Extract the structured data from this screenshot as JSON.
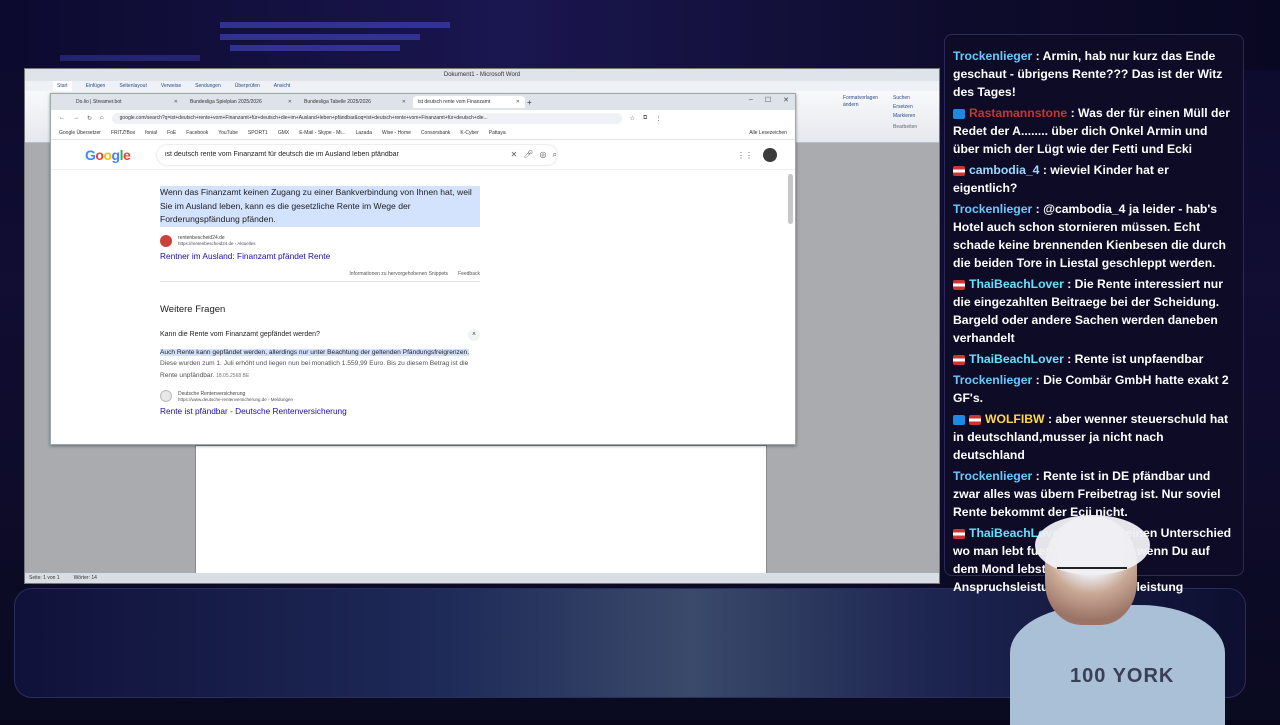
{
  "word": {
    "title": "Dokument1 - Microsoft Word",
    "tabs": [
      "Start",
      "Einfügen",
      "Seitenlayout",
      "Verweise",
      "Sendungen",
      "Überprüfen",
      "Ansicht"
    ],
    "status": [
      "Seite: 1 von 1",
      "Wörter: 14"
    ],
    "ribbon_right": [
      "Formatvorlagen ändern",
      "Suchen",
      "Ersetzen",
      "Markieren",
      "Bearbeiten"
    ]
  },
  "browser": {
    "tabs": [
      {
        "label": "Do.lio | Streamer.bot"
      },
      {
        "label": "Bundesliga Spielplan 2025/2026"
      },
      {
        "label": "Bundesliga Tabelle 2025/2026"
      },
      {
        "label": "ist deutsch rente vom Finanzamt"
      }
    ],
    "url": "google.com/search?q=ist+deutsch+rente+vom+Finanzamt+für+deutsch+die+im+Ausland+leben+pfändbar&oq=ist+deutsch+rente+vom+Finanzamt+für+deutsch+die...",
    "bookmarks": [
      "Google Übersetzer",
      "FRITZ!Box",
      "fonial",
      "FoE",
      "Facebook",
      "YouTube",
      "SPORT1",
      "GMX",
      "E-Mail - Skype - Mi...",
      "Lazada",
      "Wise - Home",
      "Consorsbank",
      "K-Cyber",
      "Pattaya"
    ],
    "bookmarks_all": "Alle Lesezeichen"
  },
  "google": {
    "query": "ist deutsch rente vom Finanzamt für deutsch die im Ausland leben pfändbar",
    "snippet1": "Wenn das Finanzamt keinen Zugang zu einer Bankverbindung von Ihnen hat, weil Sie im Ausland leben, kann es die gesetzliche Rente im Wege der Forderungspfändung pfänden.",
    "result1": {
      "site": "rentenbescheid24.de",
      "url": "https://rentenbescheid24.de › Aktuelles",
      "title": "Rentner im Ausland: Finanzamt pfändet Rente"
    },
    "info_text": "Informationen zu hervorgehobenen Snippets",
    "feedback": "Feedback",
    "weitere_fragen": "Weitere Fragen",
    "question": "Kann die Rente vom Finanzamt gepfändet werden?",
    "snippet2_hl": "Auch Rente kann gepfändet werden, allerdings nur unter Beachtung der geltenden Pfändungsfreigrenzen.",
    "snippet2_rest": " Diese wurden zum 1. Juli erhöht und liegen nun bei monatlich 1.559,99 Euro. Bis zu diesem Betrag ist die Rente unpfändbar.",
    "snippet2_date": "18.05.2568 BE",
    "result2": {
      "site": "Deutsche Rentenversicherung",
      "url": "https://www.deutsche-rentenversicherung.de › Meldungen",
      "title": "Rente ist pfändbar - Deutsche Rentenversicherung"
    }
  },
  "chat": [
    {
      "user": "Trockenlieger",
      "text": " : Armin, hab nur kurz das Ende geschaut - übrigens Rente??? Das ist der Witz des Tages!",
      "badge": ""
    },
    {
      "user": "Rastamannstone",
      "text": " : Was der für einen Müll der Redet der A........ über dich Onkel Armin und über mich der Lügt wie der Fetti und Ecki",
      "badge": "blue"
    },
    {
      "user": "cambodia_4",
      "text": " : wieviel Kinder hat er eigentlich?",
      "badge": "flag"
    },
    {
      "user": "Trockenlieger",
      "text": " : @cambodia_4 ja leider - hab's Hotel auch schon stornieren müssen. Echt schade keine brennenden Kienbesen die durch die beiden Tore in Liestal geschleppt werden.",
      "badge": ""
    },
    {
      "user": "ThaiBeachLover",
      "text": " : Die Rente interessiert nur die eingezahlten Beitraege bei der Scheidung. Bargeld oder andere Sachen werden daneben verhandelt",
      "badge": "flag"
    },
    {
      "user": "ThaiBeachLover",
      "text": " : Rente ist unpfaendbar",
      "badge": "flag"
    },
    {
      "user": "Trockenlieger",
      "text": " : Die Combär GmbH hatte exakt 2 GF's.",
      "badge": ""
    },
    {
      "user": "WOLFIBW",
      "text": " : aber wenner steuerschuld hat in deutschland,musser ja nicht nach deutschland",
      "badge": "blueflag"
    },
    {
      "user": "Trockenlieger",
      "text": " : Rente ist in DE pfändbar und zwar alles was übern Freibetrag ist. Nur soviel Rente bekommt der Ecji nicht.",
      "badge": ""
    },
    {
      "user": "ThaiBeachLover",
      "text": " : Es gibt keinen Unterschied wo man lebt fuer die Rente und wenn Du auf dem Mond lebst. Rente ist eine Anspruchsleistung keine Sozialleistung",
      "badge": "flag"
    }
  ],
  "webcam": {
    "shirt_text": "100 YORK"
  }
}
